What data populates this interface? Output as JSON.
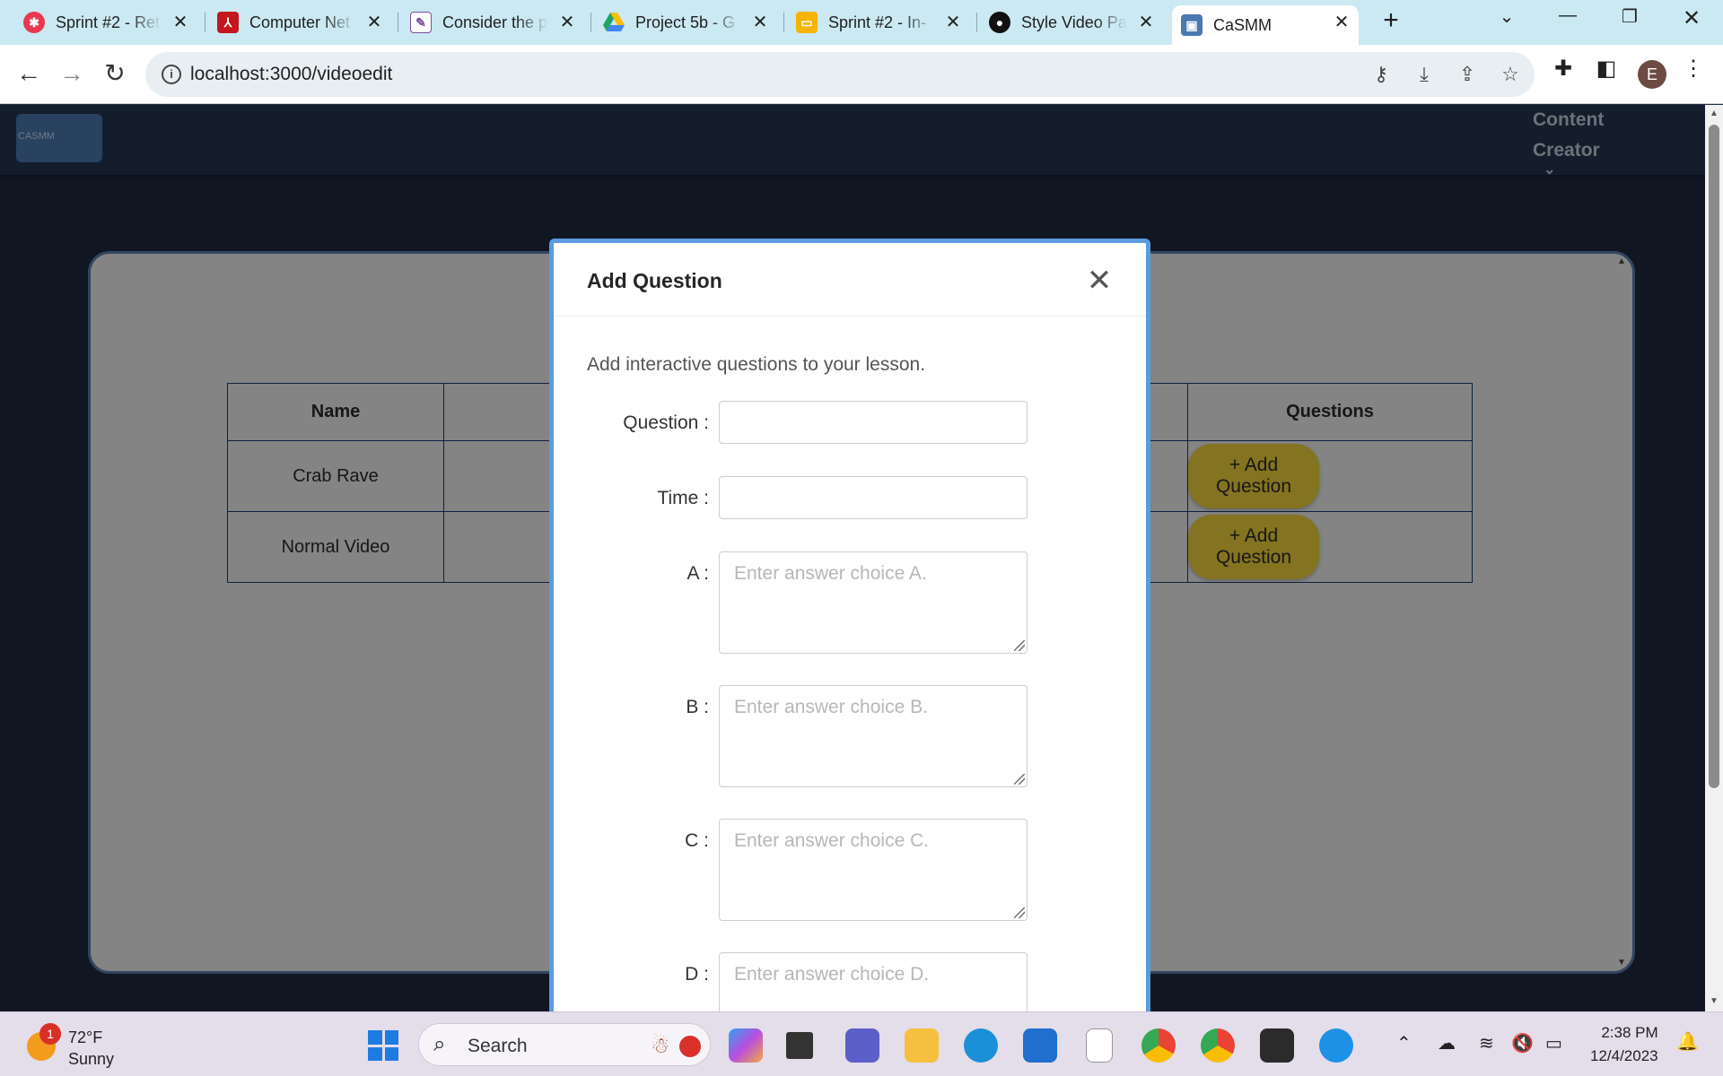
{
  "browser": {
    "tabs": [
      {
        "title": "Sprint #2 - Ret",
        "icon": "asana-icon",
        "color": "#e8384f"
      },
      {
        "title": "Computer Net",
        "icon": "pdf-icon",
        "color": "#c4161c"
      },
      {
        "title": "Consider the p",
        "icon": "document-icon",
        "color": "#7b4ea0"
      },
      {
        "title": "Project 5b - G",
        "icon": "google-drive-icon",
        "color": "#1fa463"
      },
      {
        "title": "Sprint #2 - In-",
        "icon": "google-slides-icon",
        "color": "#f4b400"
      },
      {
        "title": "Style Video Pa",
        "icon": "github-icon",
        "color": "#111111"
      },
      {
        "title": "CaSMM",
        "icon": "casmm-icon",
        "color": "#4a78b0"
      }
    ],
    "url": "localhost:3000/videoedit",
    "profile_initial": "E"
  },
  "app": {
    "logo_text": "CASMM",
    "role_line1": "Content",
    "role_line2": "Creator",
    "table": {
      "headers": [
        "Name",
        "",
        "Questions"
      ],
      "rows": [
        {
          "name": "Crab Rave",
          "action": "+ Add Question"
        },
        {
          "name": "Normal Video",
          "action": "+ Add Question"
        }
      ]
    }
  },
  "modal": {
    "title": "Add Question",
    "description": "Add interactive questions to your lesson.",
    "fields": {
      "question_label": "Question",
      "time_label": "Time",
      "a_label": "A",
      "a_placeholder": "Enter answer choice A.",
      "b_label": "B",
      "b_placeholder": "Enter answer choice B.",
      "c_label": "C",
      "c_placeholder": "Enter answer choice C.",
      "d_label": "D",
      "d_placeholder": "Enter answer choice D."
    }
  },
  "taskbar": {
    "weather_temp": "72°F",
    "weather_cond": "Sunny",
    "weather_badge": "1",
    "search_label": "Search",
    "time": "2:38 PM",
    "date": "12/4/2023"
  }
}
